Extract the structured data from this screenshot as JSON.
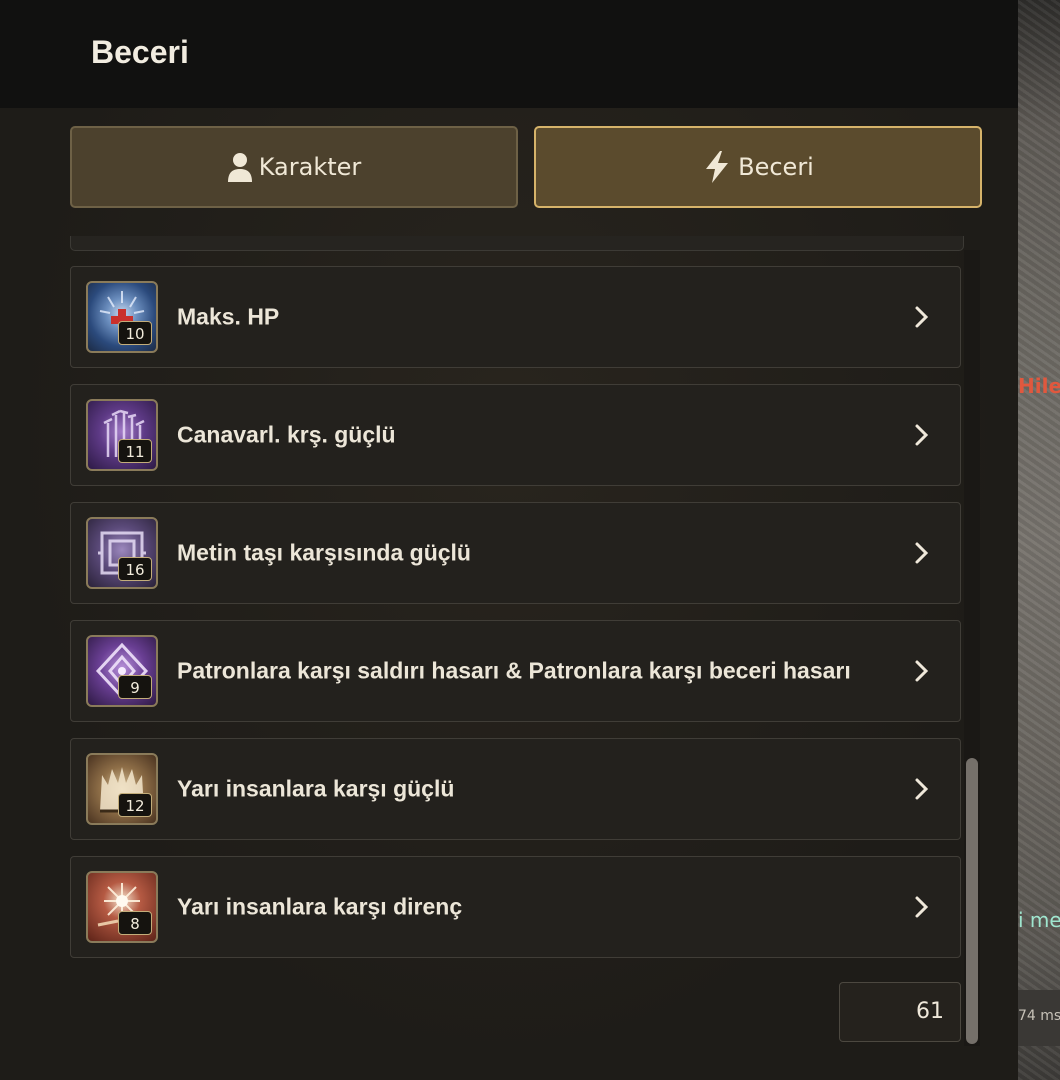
{
  "header": {
    "title": "Beceri"
  },
  "tabs": [
    {
      "label": "Karakter",
      "icon": "user-icon",
      "selected": false
    },
    {
      "label": "Beceri",
      "icon": "lightning-icon",
      "selected": true
    }
  ],
  "skills": [
    {
      "name": "Maks. HP",
      "level": "10",
      "icon": "max-hp-skill-icon"
    },
    {
      "name": "Canavarl. krş. güçlü",
      "level": "11",
      "icon": "monster-strength-skill-icon"
    },
    {
      "name": "Metin taşı karşısında güçlü",
      "level": "16",
      "icon": "metin-stone-skill-icon"
    },
    {
      "name": "Patronlara karşı saldırı hasarı & Patronlara karşı beceri hasarı",
      "level": "9",
      "icon": "boss-damage-skill-icon"
    },
    {
      "name": "Yarı insanlara karşı güçlü",
      "level": "12",
      "icon": "half-human-strength-skill-icon"
    },
    {
      "name": "Yarı insanlara karşı direnç",
      "level": "8",
      "icon": "half-human-resistance-skill-icon"
    }
  ],
  "points": "61",
  "background_text": {
    "red": "Hilel",
    "teal": "i me",
    "ms": "74 ms"
  },
  "colors": {
    "accent_border": "#d6b36a",
    "tab_selected_bg": "#5b4b2d",
    "tab_bg": "#4c412d"
  }
}
